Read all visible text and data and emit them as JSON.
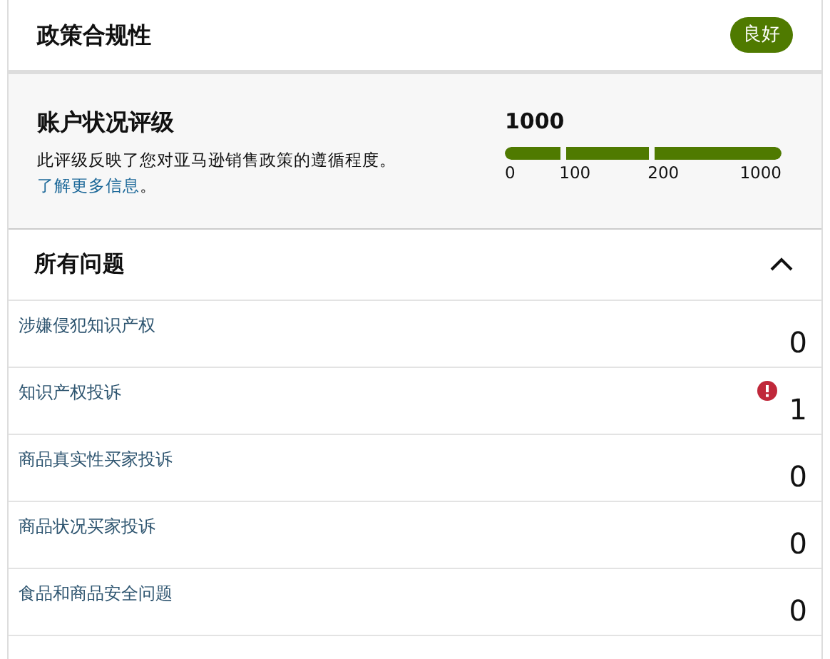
{
  "header": {
    "title": "政策合规性",
    "status": "良好"
  },
  "rating": {
    "title": "账户状况评级",
    "description": "此评级反映了您对亚马逊销售政策的遵循程度。",
    "link": "了解更多信息",
    "link_suffix": "。",
    "score": "1000",
    "level": 1,
    "ticks": [
      "0",
      "100",
      "200",
      "1000"
    ]
  },
  "issues": {
    "title": "所有问题",
    "expanded": true,
    "rows": [
      {
        "label": "涉嫌侵犯知识产权",
        "count": "0",
        "alert": false
      },
      {
        "label": "知识产权投诉",
        "count": "1",
        "alert": true
      },
      {
        "label": "商品真实性买家投诉",
        "count": "0",
        "alert": false
      },
      {
        "label": "商品状况买家投诉",
        "count": "0",
        "alert": false
      },
      {
        "label": "食品和商品安全问题",
        "count": "0",
        "alert": false
      }
    ]
  }
}
